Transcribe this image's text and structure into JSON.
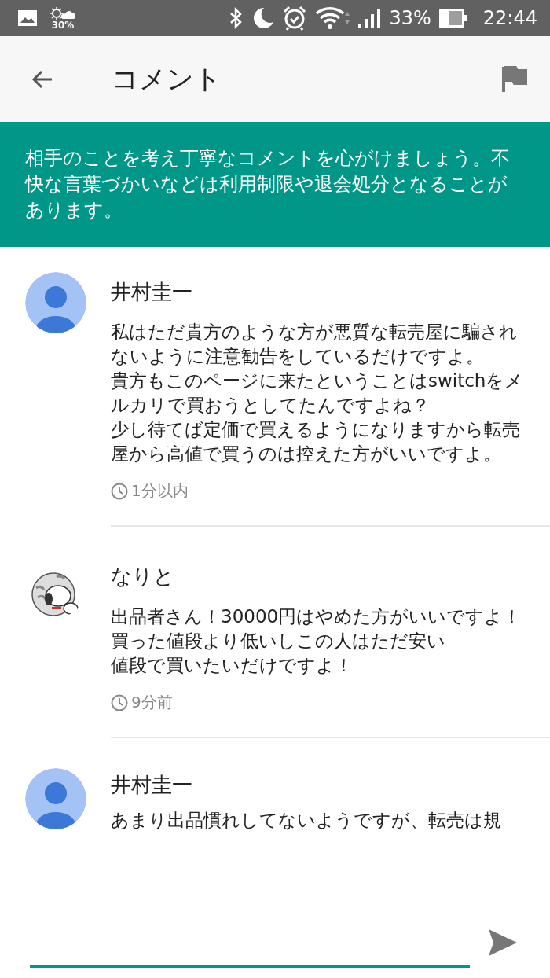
{
  "status_bar": {
    "weather_temp": "30%",
    "battery": "33%",
    "time": "22:44"
  },
  "app_bar": {
    "title": "コメント"
  },
  "notice": "相手のことを考え丁寧なコメントを心がけましょう。不快な言葉づかいなどは利用制限や退会処分となることがあります。",
  "comments": [
    {
      "kind": "default",
      "name": "井村圭一",
      "paragraphs": [
        "私はただ貴方のような方が悪質な転売屋に騙されないように注意勧告をしているだけですよ。",
        "貴方もこのページに来たということはswitchをメルカリで買おうとしてたんですよね？",
        "少し待てば定価で買えるようになりますから転売屋から高値で買うのは控えた方がいいですよ。"
      ],
      "time": "1分以内"
    },
    {
      "kind": "picture",
      "name": "なりと",
      "paragraphs": [
        "出品者さん！30000円はやめた方がいいですよ！",
        "買った値段より低いしこの人はただ安い",
        "値段で買いたいだけですよ！"
      ],
      "time": "9分前"
    },
    {
      "kind": "default",
      "name": "井村圭一",
      "paragraphs": [
        "あまり出品慣れしてないようですが、転売は規"
      ]
    }
  ]
}
